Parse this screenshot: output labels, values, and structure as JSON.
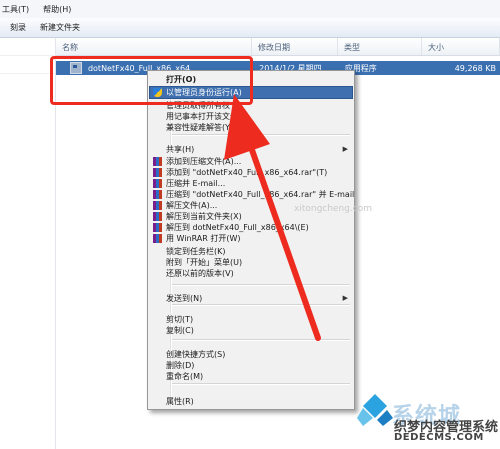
{
  "menubar": {
    "items": [
      "工具(T)",
      "帮助(H)"
    ]
  },
  "toolbar": {
    "items": [
      "刻录",
      "新建文件夹"
    ]
  },
  "columns": [
    "名称",
    "修改日期",
    "类型",
    "大小"
  ],
  "file": {
    "name": "dotNetFx40_Full_x86_x64",
    "date": "2014/1/2 星期四 ...",
    "type": "应用程序",
    "size": "49,268 KB"
  },
  "context_menu": {
    "items": [
      {
        "label": "打开(O)",
        "bold": true
      },
      {
        "label": "以管理员身份运行(A)",
        "highlighted": true,
        "icon": "uac-shield-icon"
      },
      {
        "label": "管理员取得所有权"
      },
      {
        "label": "用记事本打开该文件"
      },
      {
        "label": "兼容性疑难解答(Y)"
      },
      {
        "label": "共享(H)",
        "submenu": true
      },
      {
        "label": "添加到压缩文件(A)...",
        "icon": "winrar-icon"
      },
      {
        "label": "添加到 \"dotNetFx40_Full_x86_x64.rar\"(T)",
        "icon": "winrar-icon"
      },
      {
        "label": "压缩并 E-mail...",
        "icon": "winrar-icon"
      },
      {
        "label": "压缩到 \"dotNetFx40_Full_x86_x64.rar\" 并 E-mail",
        "icon": "winrar-icon"
      },
      {
        "label": "解压文件(A)...",
        "icon": "winrar-icon"
      },
      {
        "label": "解压到当前文件夹(X)",
        "icon": "winrar-icon"
      },
      {
        "label": "解压到 dotNetFx40_Full_x86_x64\\(E)",
        "icon": "winrar-icon"
      },
      {
        "label": "用 WinRAR 打开(W)",
        "icon": "winrar-icon"
      },
      {
        "label": "锁定到任务栏(K)"
      },
      {
        "label": "附到「开始」菜单(U)"
      },
      {
        "label": "还原以前的版本(V)"
      },
      {
        "label": "发送到(N)",
        "submenu": true
      },
      {
        "label": "剪切(T)"
      },
      {
        "label": "复制(C)"
      },
      {
        "label": "创建快捷方式(S)"
      },
      {
        "label": "删除(D)"
      },
      {
        "label": "重命名(M)"
      },
      {
        "label": "属性(R)"
      }
    ]
  },
  "watermark": {
    "ghost": "xitongcheng.com",
    "brand": "系统城",
    "site_cn": "织梦内容管理系统",
    "site_url": "DEDECMS.COM"
  },
  "colors": {
    "selection": "#3a6fb0",
    "menu_highlight": "#3f6fae",
    "annotation": "#ee2b1f"
  }
}
